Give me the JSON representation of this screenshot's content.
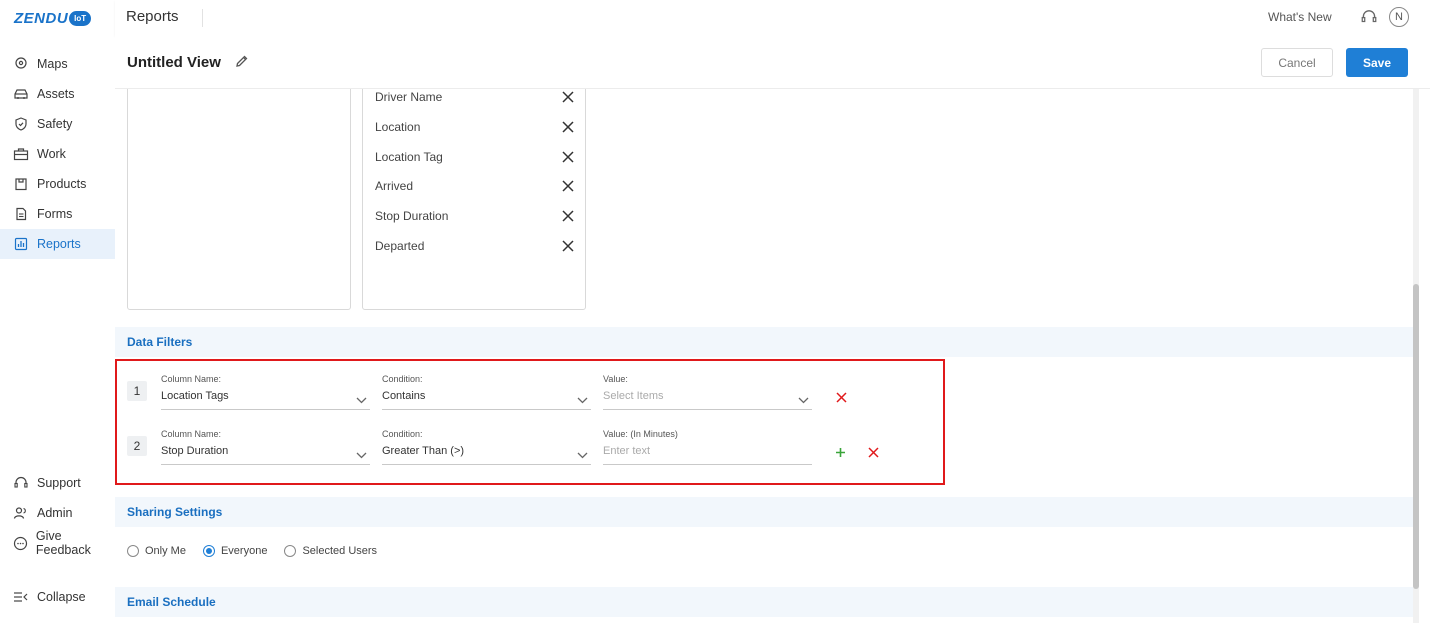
{
  "app": {
    "logo_text": "ZENDU",
    "logo_badge": "IoT"
  },
  "sidebar": {
    "items": [
      {
        "label": "Maps",
        "icon": "map-pin-icon"
      },
      {
        "label": "Assets",
        "icon": "car-icon"
      },
      {
        "label": "Safety",
        "icon": "shield-icon"
      },
      {
        "label": "Work",
        "icon": "briefcase-icon"
      },
      {
        "label": "Products",
        "icon": "box-icon"
      },
      {
        "label": "Forms",
        "icon": "document-icon"
      },
      {
        "label": "Reports",
        "icon": "chart-icon",
        "active": true
      }
    ],
    "bottom": [
      {
        "label": "Support",
        "icon": "headset-icon"
      },
      {
        "label": "Admin",
        "icon": "users-icon"
      },
      {
        "label": "Give Feedback",
        "icon": "chat-icon"
      }
    ],
    "collapse_label": "Collapse"
  },
  "topbar": {
    "title": "Reports",
    "whats_new": "What's New",
    "avatar_initial": "N"
  },
  "view": {
    "title": "Untitled View",
    "cancel_label": "Cancel",
    "save_label": "Save"
  },
  "columns": {
    "selected": [
      "Driver Name",
      "Location",
      "Location Tag",
      "Arrived",
      "Stop Duration",
      "Departed"
    ]
  },
  "data_filters": {
    "heading": "Data Filters",
    "rows": [
      {
        "num": "1",
        "column_label": "Column Name:",
        "column_value": "Location Tags",
        "condition_label": "Condition:",
        "condition_value": "Contains",
        "value_label": "Value:",
        "value_placeholder": "Select Items"
      },
      {
        "num": "2",
        "column_label": "Column Name:",
        "column_value": "Stop Duration",
        "condition_label": "Condition:",
        "condition_value": "Greater Than (>)",
        "value_label": "Value: (In Minutes)",
        "value_placeholder": "Enter text"
      }
    ]
  },
  "sharing": {
    "heading": "Sharing Settings",
    "options": [
      "Only Me",
      "Everyone",
      "Selected Users"
    ],
    "selected": "Everyone"
  },
  "email_schedule": {
    "heading": "Email Schedule"
  },
  "colors": {
    "accent": "#1f7fd6",
    "highlight_border": "#e0191b",
    "add": "#3aa53a",
    "remove": "#e0191b"
  }
}
